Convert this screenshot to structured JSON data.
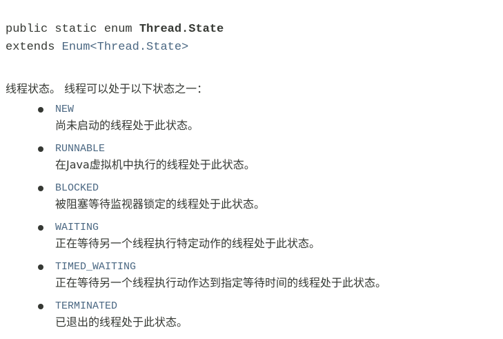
{
  "signature": {
    "prefix": "public static enum ",
    "class_name": "Thread.State",
    "extends_keyword": "extends ",
    "extends_type": "Enum<Thread.State>"
  },
  "description": "线程状态。 线程可以处于以下状态之一：",
  "states": [
    {
      "name": "NEW",
      "description": "尚未启动的线程处于此状态。"
    },
    {
      "name": "RUNNABLE",
      "description": "在Java虚拟机中执行的线程处于此状态。"
    },
    {
      "name": "BLOCKED",
      "description": "被阻塞等待监视器锁定的线程处于此状态。"
    },
    {
      "name": "WAITING",
      "description": "正在等待另一个线程执行特定动作的线程处于此状态。"
    },
    {
      "name": "TIMED_WAITING",
      "description": "正在等待另一个线程执行动作达到指定等待时间的线程处于此状态。"
    },
    {
      "name": "TERMINATED",
      "description": "已退出的线程处于此状态。"
    }
  ],
  "colors": {
    "text": "#353833",
    "link": "#4a6782",
    "background": "#ffffff"
  }
}
